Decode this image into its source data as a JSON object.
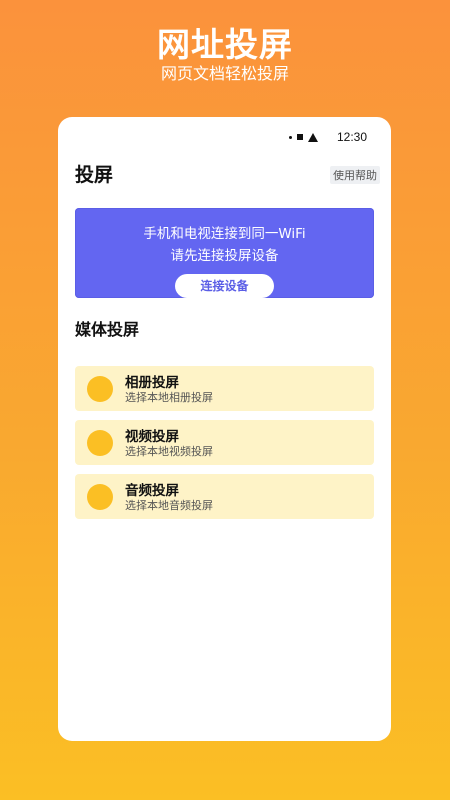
{
  "hero": {
    "title": "网址投屏",
    "subtitle": "网页文档轻松投屏"
  },
  "status_bar": {
    "time": "12:30"
  },
  "header": {
    "title": "投屏",
    "help_label": "使用帮助"
  },
  "banner": {
    "line1": "手机和电视连接到同一WiFi",
    "line2": "请先连接投屏设备",
    "button_label": "连接设备"
  },
  "media_section": {
    "title": "媒体投屏",
    "items": [
      {
        "name": "相册投屏",
        "desc": "选择本地相册投屏"
      },
      {
        "name": "视频投屏",
        "desc": "选择本地视频投屏"
      },
      {
        "name": "音频投屏",
        "desc": "选择本地音频投屏"
      }
    ]
  },
  "colors": {
    "accent": "#6366F1",
    "item_bg": "#FEF3C7",
    "item_icon": "#FBBF24"
  }
}
